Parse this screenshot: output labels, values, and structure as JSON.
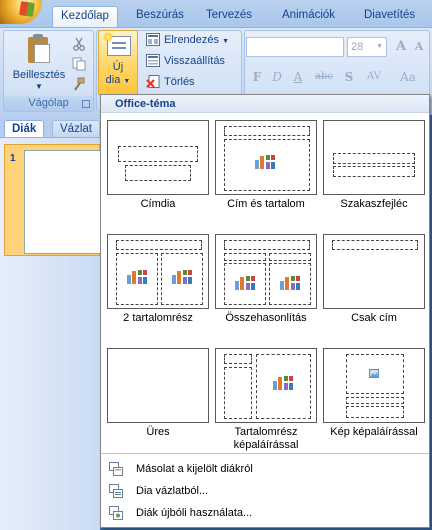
{
  "ribbon": {
    "tabs": [
      {
        "label": "Kezdőlap",
        "active": true
      },
      {
        "label": "Beszúrás",
        "active": false
      },
      {
        "label": "Tervezés",
        "active": false
      },
      {
        "label": "Animációk",
        "active": false
      },
      {
        "label": "Diavetítés",
        "active": false
      }
    ],
    "clipboard": {
      "paste_label": "Beillesztés",
      "group_label": "Vágólap",
      "icons": [
        "scissors-icon",
        "copy-icon",
        "format-painter-icon"
      ]
    },
    "slides": {
      "new_slide_label_line1": "Új",
      "new_slide_label_line2": "dia",
      "layout_label": "Elrendezés",
      "reset_label": "Visszaállítás",
      "delete_label": "Törlés"
    },
    "font": {
      "font_name": "",
      "font_size": "28",
      "format_buttons": [
        "F",
        "D",
        "A",
        "abc",
        "S",
        "AV",
        "Aa"
      ]
    }
  },
  "slides_pane": {
    "tabs": [
      {
        "label": "Diák",
        "active": true
      },
      {
        "label": "Vázlat",
        "active": false
      }
    ],
    "thumbnail_number": "1"
  },
  "layout_gallery": {
    "header": "Office-téma",
    "layouts": [
      {
        "id": "title",
        "label": "Címdia"
      },
      {
        "id": "title-content",
        "label": "Cím és tartalom"
      },
      {
        "id": "section-header",
        "label": "Szakaszfejléc"
      },
      {
        "id": "two-content",
        "label": "2 tartalomrész"
      },
      {
        "id": "comparison",
        "label": "Összehasonlítás"
      },
      {
        "id": "title-only",
        "label": "Csak cím"
      },
      {
        "id": "blank",
        "label": "Üres"
      },
      {
        "id": "content-caption",
        "label": "Tartalomrész képaláírással"
      },
      {
        "id": "picture-caption",
        "label": "Kép képaláírással"
      }
    ],
    "commands": [
      {
        "label": "Másolat a kijelölt diákról"
      },
      {
        "label": "Dia vázlatból..."
      },
      {
        "label": "Diák újbóli használata..."
      }
    ]
  },
  "colors": {
    "accent_orange": "#ffc43c",
    "ribbon_blue": "#c7daf3",
    "text_blue": "#15428b"
  }
}
